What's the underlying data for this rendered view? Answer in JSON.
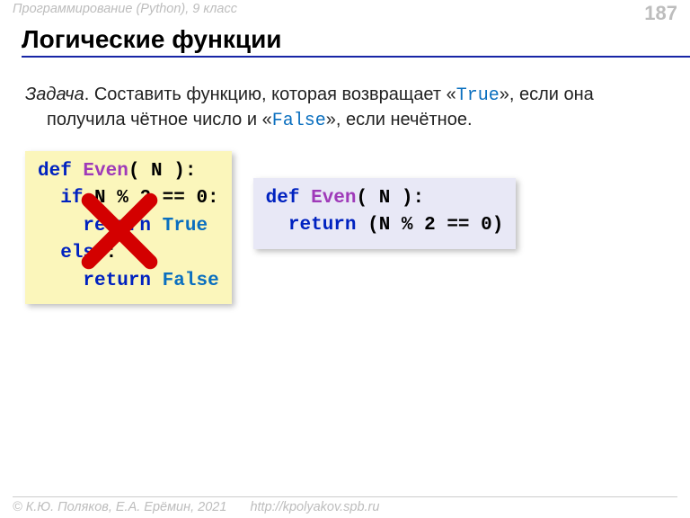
{
  "header": {
    "course": "Программирование (Python), 9 класс",
    "page": "187"
  },
  "title": "Логические функции",
  "task": {
    "intro": "Задача",
    "dot": ". ",
    "part1": "Составить функцию, которая возвращает «",
    "true": "True",
    "part2": "», если она получила чётное число и «",
    "false": "False",
    "part3": "», если нечётное."
  },
  "code1": {
    "l1_def": "def",
    "l1_sp": " ",
    "l1_fn": "Even",
    "l1_rest": "( N ):",
    "l2_ind": "  ",
    "l2_if": "if",
    "l2_eq": " N % 2 == 0:",
    "l3_ind": "    ",
    "l3_ret": "return",
    "l3_sp": " ",
    "l3_true": "True",
    "l4_ind": "  ",
    "l4_else": "else",
    "l4_colon": ":",
    "l5_ind": "    ",
    "l5_ret": "return",
    "l5_sp": " ",
    "l5_false": "False"
  },
  "code2": {
    "l1_def": "def",
    "l1_sp": " ",
    "l1_fn": "Even",
    "l1_rest": "( N ):",
    "l2_ind": "  ",
    "l2_ret": "return",
    "l2_rest": " (N % 2 == 0)"
  },
  "footer": {
    "copyright": "© К.Ю. Поляков, Е.А. Ерёмин, 2021",
    "url": "http://kpolyakov.spb.ru"
  }
}
